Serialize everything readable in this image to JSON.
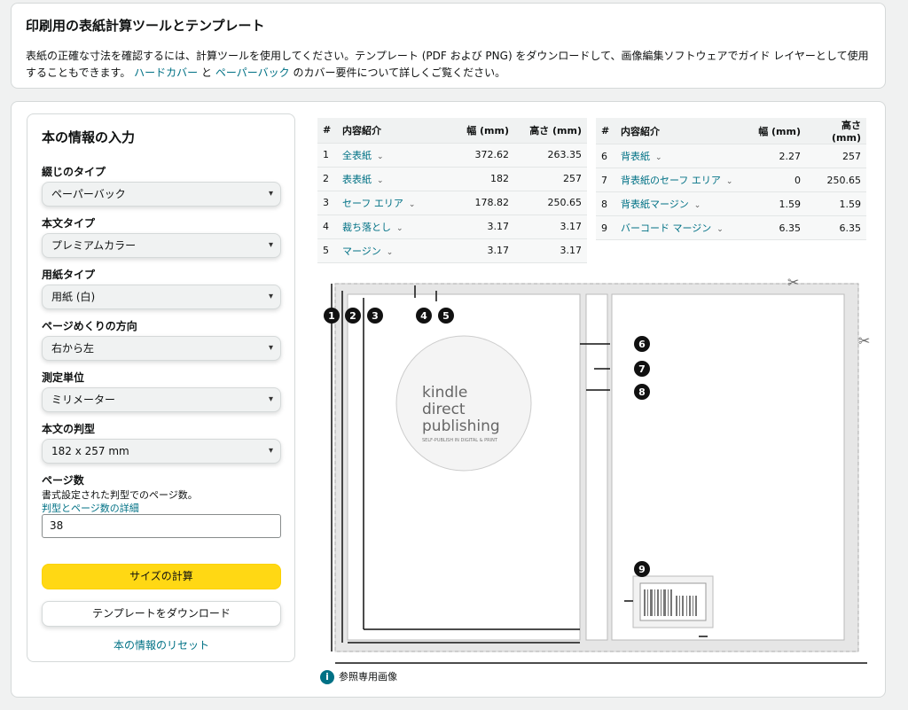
{
  "header": {
    "title": "印刷用の表紙計算ツールとテンプレート",
    "desc_part1": "表紙の正確な寸法を確認するには、計算ツールを使用してください。テンプレート (PDF および PNG) をダウンロードして、画像編集ソフトウェアでガイド レイヤーとして使用することもできます。",
    "link_hardcover": "ハードカバー",
    "desc_and": "と",
    "link_paperback": "ペーパーバック",
    "desc_part2": "のカバー要件について詳しくご覧ください。"
  },
  "form": {
    "title": "本の情報の入力",
    "binding_label": "綴じのタイプ",
    "binding_value": "ペーパーバック",
    "interior_label": "本文タイプ",
    "interior_value": "プレミアムカラー",
    "paper_label": "用紙タイプ",
    "paper_value": "用紙 (白)",
    "direction_label": "ページめくりの方向",
    "direction_value": "右から左",
    "unit_label": "測定単位",
    "unit_value": "ミリメーター",
    "trim_label": "本文の判型",
    "trim_value": "182 x 257 mm",
    "pages_label": "ページ数",
    "pages_help": "書式設定された判型でのページ数。",
    "pages_link": "判型とページ数の詳細",
    "pages_value": "38",
    "calc_button": "サイズの計算",
    "download_button": "テンプレートをダウンロード",
    "reset_link": "本の情報のリセット"
  },
  "table_headers": {
    "num": "#",
    "content": "内容紹介",
    "width": "幅 (mm)",
    "height": "高さ (mm)"
  },
  "table_left": [
    {
      "n": "1",
      "name": "全表紙",
      "w": "372.62",
      "h": "263.35"
    },
    {
      "n": "2",
      "name": "表表紙",
      "w": "182",
      "h": "257"
    },
    {
      "n": "3",
      "name": "セーフ エリア",
      "w": "178.82",
      "h": "250.65"
    },
    {
      "n": "4",
      "name": "裁ち落とし",
      "w": "3.17",
      "h": "3.17"
    },
    {
      "n": "5",
      "name": "マージン",
      "w": "3.17",
      "h": "3.17"
    }
  ],
  "table_right": [
    {
      "n": "6",
      "name": "背表紙",
      "w": "2.27",
      "h": "257"
    },
    {
      "n": "7",
      "name": "背表紙のセーフ エリア",
      "w": "0",
      "h": "250.65"
    },
    {
      "n": "8",
      "name": "背表紙マージン",
      "w": "1.59",
      "h": "1.59"
    },
    {
      "n": "9",
      "name": "バーコード マージン",
      "w": "6.35",
      "h": "6.35"
    }
  ],
  "diagram": {
    "logo_line1": "kindle",
    "logo_line2": "direct",
    "logo_line3": "publishing",
    "logo_tagline": "SELF-PUBLISH IN DIGITAL & PRINT",
    "markers": [
      "1",
      "2",
      "3",
      "4",
      "5",
      "6",
      "7",
      "8",
      "9"
    ]
  },
  "reference_note": "参照専用画像",
  "colors": {
    "accent_link": "#007185",
    "primary_button": "#ffd814"
  }
}
